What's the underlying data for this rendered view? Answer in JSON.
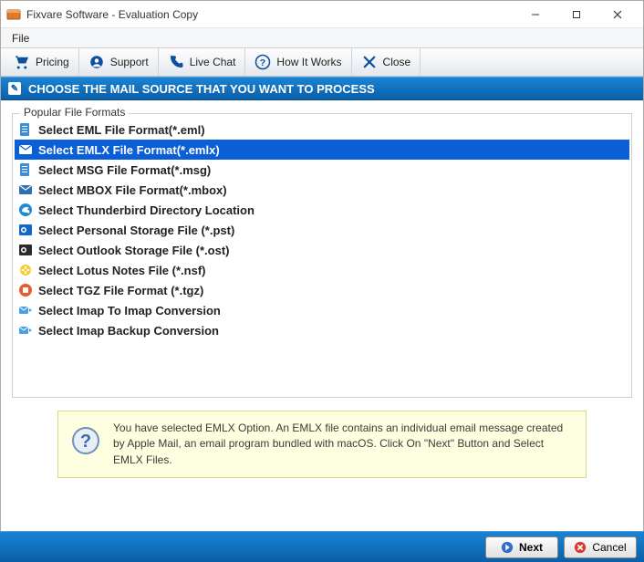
{
  "window": {
    "title": "Fixvare Software - Evaluation Copy"
  },
  "menubar": {
    "file": "File"
  },
  "toolbar": {
    "pricing": "Pricing",
    "support": "Support",
    "livechat": "Live Chat",
    "howitworks": "How It Works",
    "close": "Close"
  },
  "banner": {
    "text": "CHOOSE THE MAIL SOURCE THAT YOU WANT TO PROCESS"
  },
  "formats": {
    "legend": "Popular File Formats",
    "items": [
      {
        "label": "Select EML File Format(*.eml)",
        "icon": "file-blue",
        "selected": false
      },
      {
        "label": "Select EMLX File Format(*.emlx)",
        "icon": "file-mail",
        "selected": true
      },
      {
        "label": "Select MSG File Format(*.msg)",
        "icon": "file-blue",
        "selected": false
      },
      {
        "label": "Select MBOX File Format(*.mbox)",
        "icon": "file-mail",
        "selected": false
      },
      {
        "label": "Select Thunderbird Directory Location",
        "icon": "thunderbird",
        "selected": false
      },
      {
        "label": "Select Personal Storage File (*.pst)",
        "icon": "outlook",
        "selected": false
      },
      {
        "label": "Select Outlook Storage File (*.ost)",
        "icon": "outlook-dark",
        "selected": false
      },
      {
        "label": "Select Lotus Notes File (*.nsf)",
        "icon": "lotus",
        "selected": false
      },
      {
        "label": "Select TGZ File Format (*.tgz)",
        "icon": "tgz",
        "selected": false
      },
      {
        "label": "Select Imap To Imap Conversion",
        "icon": "imap",
        "selected": false
      },
      {
        "label": "Select Imap Backup Conversion",
        "icon": "imap",
        "selected": false
      }
    ]
  },
  "info": {
    "text": "You have selected EMLX Option. An EMLX file contains an individual email message created by Apple Mail, an email program bundled with macOS. Click On \"Next\" Button and Select EMLX Files."
  },
  "footer": {
    "next": "Next",
    "cancel": "Cancel"
  }
}
